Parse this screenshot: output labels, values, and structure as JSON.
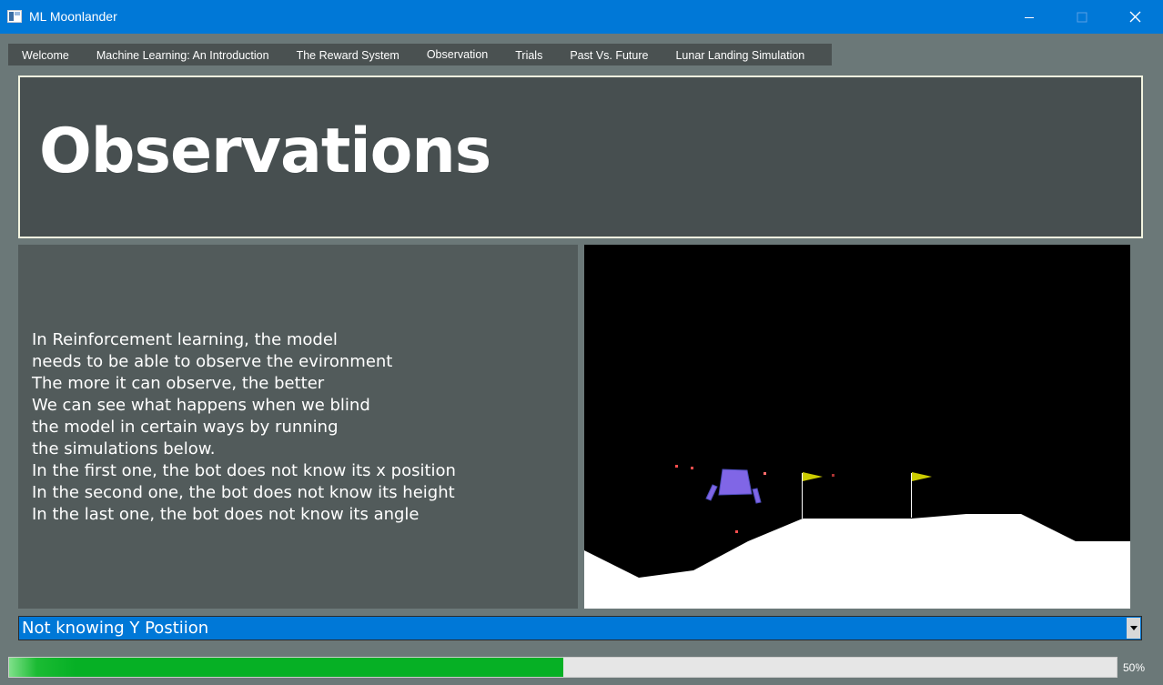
{
  "window": {
    "title": "ML Moonlander",
    "icons": {
      "app": "app-window-icon",
      "minimize": "minimize-icon",
      "maximize": "maximize-icon",
      "close": "close-icon"
    },
    "accent": "#0078d7"
  },
  "tabs": [
    {
      "label": "Welcome"
    },
    {
      "label": "Machine Learning: An Introduction"
    },
    {
      "label": "The Reward System"
    },
    {
      "label": "Observation",
      "active": true
    },
    {
      "label": "Trials"
    },
    {
      "label": "Past Vs. Future"
    },
    {
      "label": "Lunar Landing Simulation"
    }
  ],
  "header": {
    "title": "Observations"
  },
  "body_text": {
    "lines": [
      "In Reinforcement learning, the model",
      "needs to be able to observe the evironment",
      "The more it can observe, the better",
      "We can see what happens when we blind",
      "the model in certain ways by running",
      "the simulations below.",
      "In the first one, the bot does not know its x position",
      "In the second one, the bot does not know its height",
      "In the last one, the bot does not know its angle"
    ]
  },
  "simulation": {
    "scene": "lunar-lander",
    "colors": {
      "sky": "#000000",
      "ground": "#ffffff",
      "lander": "#8066e6",
      "flag": "#cccc00",
      "particles": "#ff4040"
    }
  },
  "dropdown": {
    "selected": "Not knowing Y Postiion",
    "arrow_icon": "chevron-down-icon"
  },
  "progress": {
    "percent": 50,
    "label": "50%",
    "color": "#06b025"
  }
}
